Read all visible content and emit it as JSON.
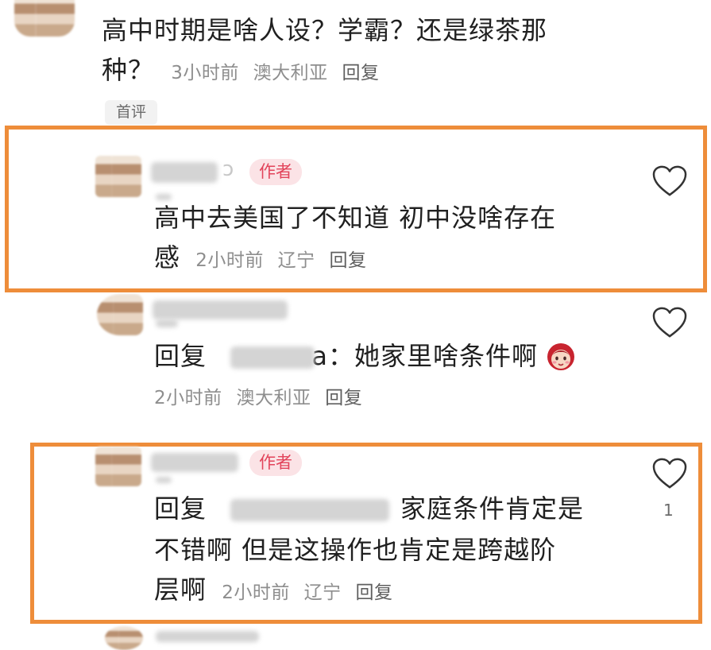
{
  "comments": [
    {
      "line1": "高中时期是啥人设？学霸？还是绿茶那",
      "line2": "种？",
      "meta": {
        "time": "3小时前",
        "location": "澳大利亚",
        "reply": "回复"
      },
      "tag": "首评"
    },
    {
      "name_fragment": "ɔ",
      "badge": "作者",
      "line1": "高中去美国了不知道 初中没啥存在",
      "line2": "感",
      "meta": {
        "time": "2小时前",
        "location": "辽宁",
        "reply": "回复"
      }
    },
    {
      "reply_prefix": "回复",
      "reply_fragment": "a：她家里啥条件啊",
      "meta": {
        "time": "2小时前",
        "location": "澳大利亚",
        "reply": "回复"
      }
    },
    {
      "badge": "作者",
      "reply_prefix": "回复",
      "line1_tail": "家庭条件肯定是",
      "line2": "不错啊 但是这操作也肯定是跨越阶",
      "line3": "层啊",
      "meta": {
        "time": "2小时前",
        "location": "辽宁",
        "reply": "回复"
      },
      "like_count": "1"
    }
  ],
  "icons": {
    "like": "heart-outline-icon",
    "emoji": "blushing-girl-emoji-icon"
  },
  "colors": {
    "highlight": "#ee8d3a",
    "author_badge_bg": "#fbe3e6",
    "author_badge_text": "#e2445b"
  }
}
